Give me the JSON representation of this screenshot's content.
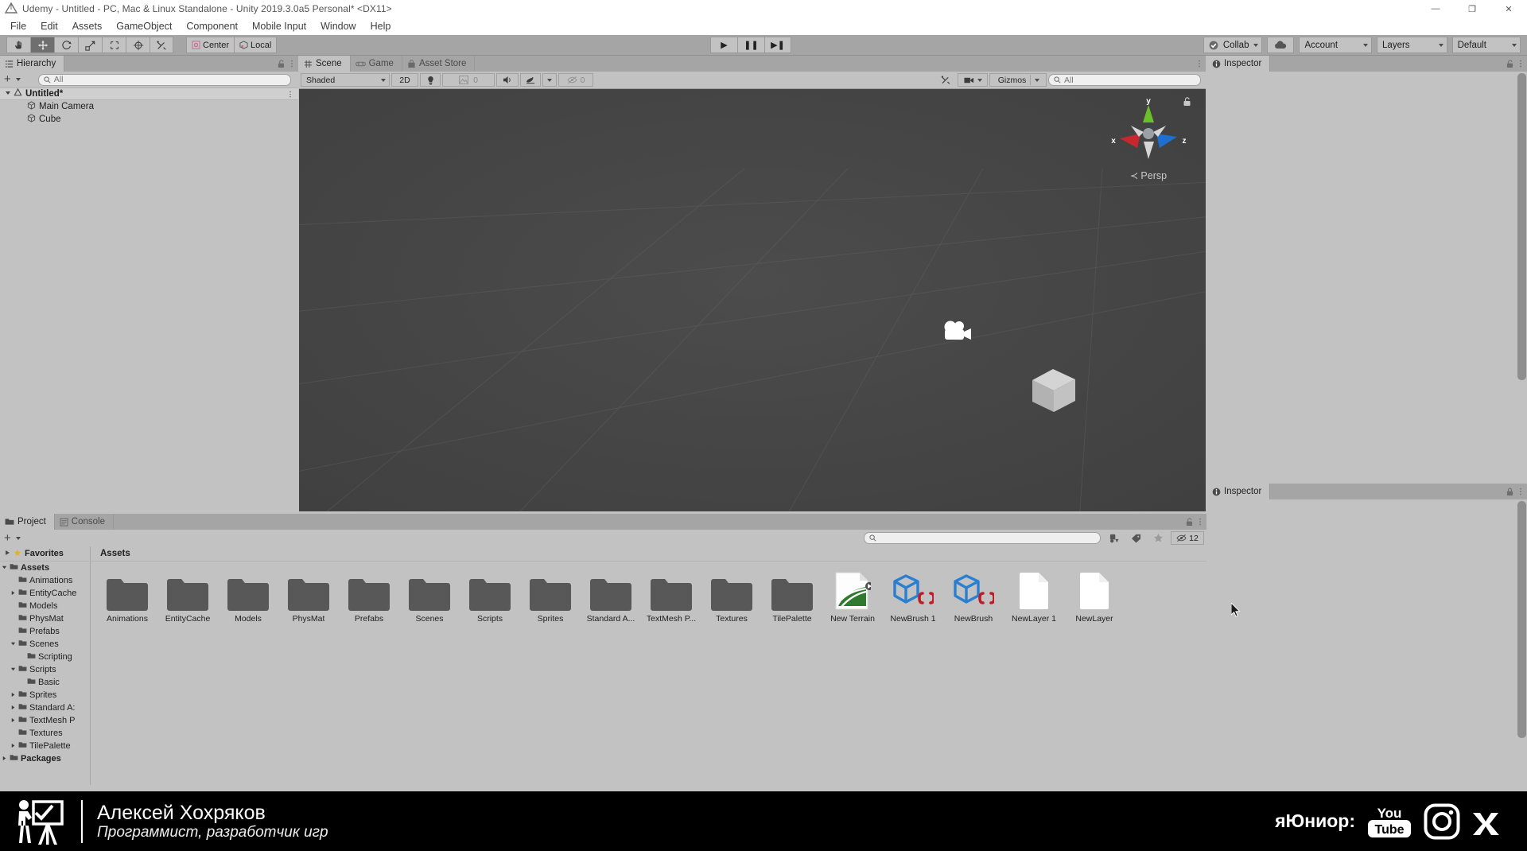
{
  "window": {
    "title": "Udemy - Untitled - PC, Mac & Linux Standalone - Unity 2019.3.0a5 Personal* <DX11>",
    "logo_icon": "unity-logo-icon",
    "minimize_label": "—",
    "maximize_label": "❐",
    "close_label": "✕"
  },
  "menubar": {
    "items": [
      {
        "label": "File"
      },
      {
        "label": "Edit"
      },
      {
        "label": "Assets"
      },
      {
        "label": "GameObject"
      },
      {
        "label": "Component"
      },
      {
        "label": "Mobile Input"
      },
      {
        "label": "Window"
      },
      {
        "label": "Help"
      }
    ]
  },
  "toolbar": {
    "transform_tools": [
      {
        "name": "hand-tool",
        "icon": "hand-icon",
        "active": false
      },
      {
        "name": "move-tool",
        "icon": "move-arrows-icon",
        "active": true
      },
      {
        "name": "rotate-tool",
        "icon": "rotate-icon",
        "active": false
      },
      {
        "name": "scale-tool",
        "icon": "scale-icon",
        "active": false
      },
      {
        "name": "rect-tool",
        "icon": "rect-transform-icon",
        "active": false
      },
      {
        "name": "transform-tool",
        "icon": "combined-transform-icon",
        "active": false
      },
      {
        "name": "custom-editor-tool",
        "icon": "wrench-screwdriver-icon",
        "active": false
      }
    ],
    "pivot_mode_label": "Center",
    "pivot_rotation_label": "Local",
    "play_label": "▶",
    "pause_label": "❚❚",
    "step_label": "▶❚",
    "collab_label": "Collab",
    "cloud_icon": "cloud-icon",
    "account_label": "Account",
    "layers_label": "Layers",
    "layout_label": "Default"
  },
  "hierarchy": {
    "tab_label": "Hierarchy",
    "tab_icon": "hierarchy-icon",
    "lock_icon": "lock-open-icon",
    "menu_icon": "kebab-menu-icon",
    "add_label": "+",
    "search_placeholder": "All",
    "search_value": "",
    "scene_name": "Untitled*",
    "objects": [
      {
        "label": "Main Camera",
        "icon": "gameobject-cube-icon"
      },
      {
        "label": "Cube",
        "icon": "gameobject-cube-icon"
      }
    ]
  },
  "scene_view": {
    "tabs": [
      {
        "label": "Scene",
        "icon": "scene-grid-icon",
        "active": true
      },
      {
        "label": "Game",
        "icon": "game-controller-icon",
        "active": false
      },
      {
        "label": "Asset Store",
        "icon": "asset-store-bag-icon",
        "active": false
      }
    ],
    "menu_icon": "kebab-menu-icon",
    "draw_mode_label": "Shaded",
    "mode_2d_label": "2D",
    "lighting_icon": "lightbulb-icon",
    "audio_icon": "speaker-icon",
    "fx_icon": "effects-icon",
    "image_effects_value": "0",
    "hidden_objects_value": "0",
    "scene_camera_icon": "camera-settings-icon",
    "gizmos_label": "Gizmos",
    "search_placeholder": "All",
    "search_value": "",
    "gizmo": {
      "y_label": "y",
      "x_label": "x",
      "z_label": "z",
      "perspective_label": "Persp",
      "lock_icon": "lock-open-icon",
      "x_color": "#c8282d",
      "y_color": "#6bbf2a",
      "z_color": "#1f6fd0"
    },
    "objects": [
      {
        "name": "main-camera-gizmo",
        "icon": "movie-camera-icon"
      },
      {
        "name": "cube-mesh",
        "icon": "cube-3d"
      }
    ]
  },
  "inspector_top": {
    "tab_label": "Inspector",
    "tab_icon": "info-circle-icon",
    "lock_icon": "lock-open-icon",
    "menu_icon": "kebab-menu-icon"
  },
  "inspector_bottom": {
    "tab_label": "Inspector",
    "tab_icon": "info-circle-icon",
    "lock_icon": "lock-closed-icon",
    "menu_icon": "kebab-menu-icon"
  },
  "project": {
    "tabs": [
      {
        "label": "Project",
        "icon": "folder-tab-icon",
        "active": true
      },
      {
        "label": "Console",
        "icon": "console-icon",
        "active": false
      }
    ],
    "lock_icon": "lock-open-icon",
    "menu_icon": "kebab-menu-icon",
    "add_label": "+",
    "search_placeholder": "",
    "search_value": "",
    "filter_type_icon": "filter-by-type-icon",
    "filter_label_icon": "filter-by-label-icon",
    "favorite_icon": "star-icon",
    "hidden_count_icon": "hidden-packages-icon",
    "hidden_count_value": "12",
    "breadcrumb": "Assets",
    "favorites_label": "Favorites",
    "favorites_icon": "star-icon",
    "tree": [
      {
        "label": "Assets",
        "depth": 0,
        "arrow": "down",
        "bold": true
      },
      {
        "label": "Animations",
        "depth": 1,
        "arrow": "none",
        "bold": false
      },
      {
        "label": "EntityCache",
        "depth": 1,
        "arrow": "right",
        "bold": false
      },
      {
        "label": "Models",
        "depth": 1,
        "arrow": "none",
        "bold": false
      },
      {
        "label": "PhysMat",
        "depth": 1,
        "arrow": "none",
        "bold": false
      },
      {
        "label": "Prefabs",
        "depth": 1,
        "arrow": "none",
        "bold": false
      },
      {
        "label": "Scenes",
        "depth": 1,
        "arrow": "down",
        "bold": false
      },
      {
        "label": "Scripting",
        "depth": 2,
        "arrow": "none",
        "bold": false
      },
      {
        "label": "Scripts",
        "depth": 1,
        "arrow": "down",
        "bold": false
      },
      {
        "label": "Basic",
        "depth": 2,
        "arrow": "none",
        "bold": false
      },
      {
        "label": "Sprites",
        "depth": 1,
        "arrow": "right",
        "bold": false
      },
      {
        "label": "Standard A:",
        "depth": 1,
        "arrow": "right",
        "bold": false
      },
      {
        "label": "TextMesh P",
        "depth": 1,
        "arrow": "right",
        "bold": false
      },
      {
        "label": "Textures",
        "depth": 1,
        "arrow": "none",
        "bold": false
      },
      {
        "label": "TilePalette",
        "depth": 1,
        "arrow": "right",
        "bold": false
      },
      {
        "label": "Packages",
        "depth": 0,
        "arrow": "right",
        "bold": true
      }
    ],
    "assets": [
      {
        "label": "Animations",
        "type": "folder"
      },
      {
        "label": "EntityCache",
        "type": "folder"
      },
      {
        "label": "Models",
        "type": "folder"
      },
      {
        "label": "PhysMat",
        "type": "folder"
      },
      {
        "label": "Prefabs",
        "type": "folder"
      },
      {
        "label": "Scenes",
        "type": "folder"
      },
      {
        "label": "Scripts",
        "type": "folder"
      },
      {
        "label": "Sprites",
        "type": "folder"
      },
      {
        "label": "Standard A...",
        "type": "folder"
      },
      {
        "label": "TextMesh P...",
        "type": "folder"
      },
      {
        "label": "Textures",
        "type": "folder"
      },
      {
        "label": "TilePalette",
        "type": "folder"
      },
      {
        "label": "New Terrain",
        "type": "terrain"
      },
      {
        "label": "NewBrush 1",
        "type": "brush"
      },
      {
        "label": "NewBrush",
        "type": "brush"
      },
      {
        "label": "NewLayer 1",
        "type": "asset"
      },
      {
        "label": "NewLayer",
        "type": "asset"
      }
    ]
  },
  "banner": {
    "presenter_icon": "presenter-whiteboard-icon",
    "name": "Алексей Хохряков",
    "role": "Программист, разработчик игр",
    "channel_label": "яЮниор:",
    "socials": [
      {
        "name": "youtube-icon",
        "label": "You Tube"
      },
      {
        "name": "instagram-icon",
        "label": ""
      },
      {
        "name": "vk-icon",
        "label": ""
      }
    ]
  },
  "colors": {
    "chrome": "#c2c2c2",
    "chrome_dark": "#a5a5a5",
    "scene_bg": "#484848",
    "accent_blue": "#2b7fd1",
    "accent_red": "#c2282d",
    "banner_bg": "#000000"
  }
}
